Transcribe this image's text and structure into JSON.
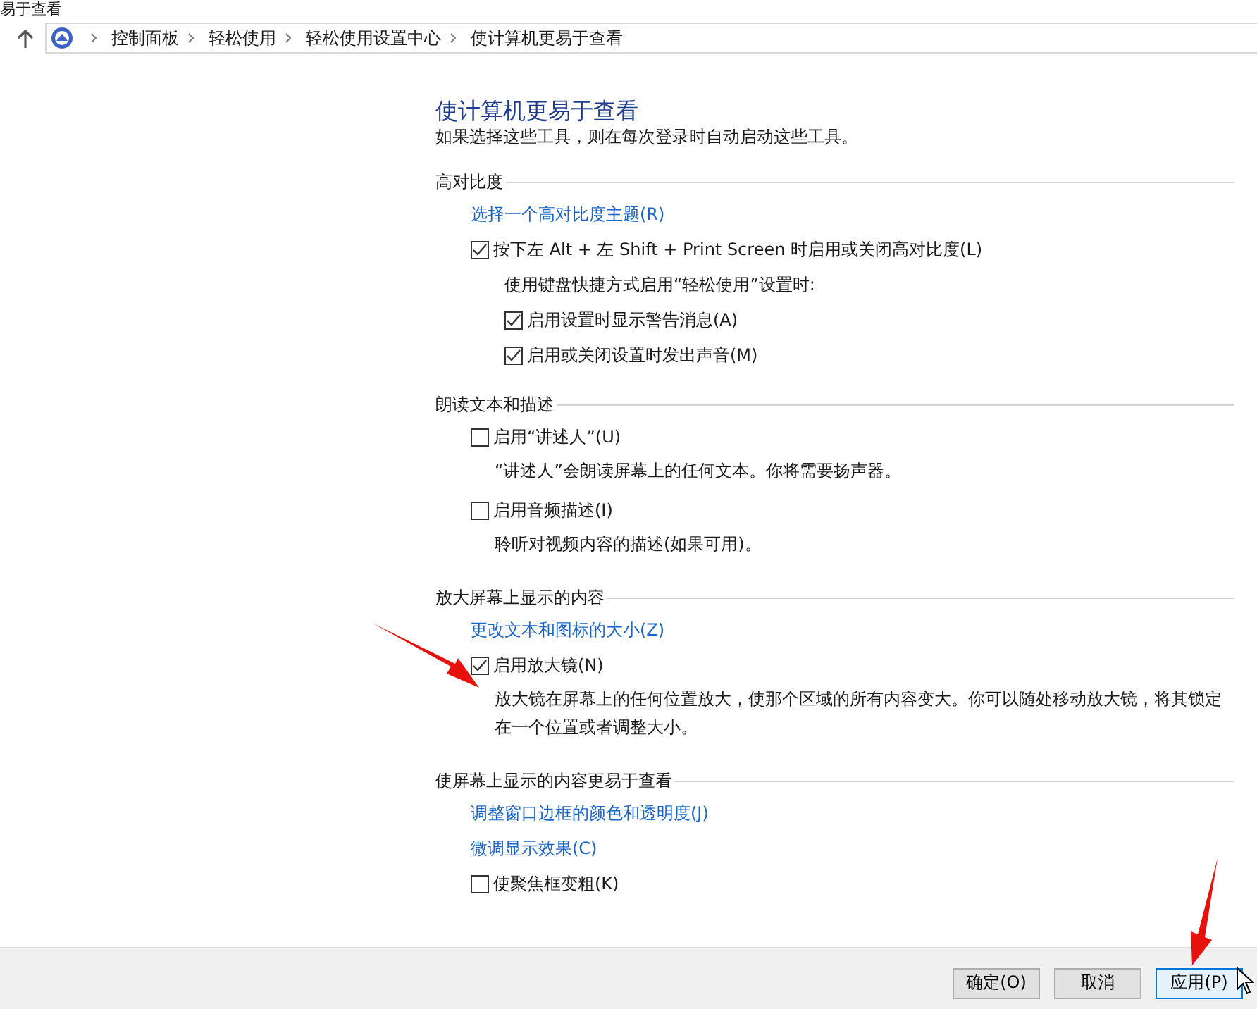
{
  "window": {
    "title": "易于查看"
  },
  "breadcrumb": [
    "控制面板",
    "轻松使用",
    "轻松使用设置中心",
    "使计算机更易于查看"
  ],
  "page": {
    "title": "使计算机更易于查看",
    "subtitle": "如果选择这些工具，则在每次登录时自动启动这些工具。"
  },
  "sections": [
    {
      "heading": "高对比度",
      "items": [
        {
          "kind": "link",
          "label": "选择一个高对比度主题(R)"
        },
        {
          "kind": "checkbox",
          "label": "按下左 Alt + 左 Shift + Print Screen 时启用或关闭高对比度(L)",
          "checked": true,
          "children": [
            {
              "kind": "note",
              "label": "使用键盘快捷方式启用“轻松使用”设置时:"
            },
            {
              "kind": "checkbox",
              "label": "启用设置时显示警告消息(A)",
              "checked": true
            },
            {
              "kind": "checkbox",
              "label": "启用或关闭设置时发出声音(M)",
              "checked": true
            }
          ]
        }
      ]
    },
    {
      "heading": "朗读文本和描述",
      "items": [
        {
          "kind": "checkbox",
          "label": "启用“讲述人”(U)",
          "checked": false,
          "description": "“讲述人”会朗读屏幕上的任何文本。你将需要扬声器。"
        },
        {
          "kind": "checkbox",
          "label": "启用音频描述(I)",
          "checked": false,
          "description": "聆听对视频内容的描述(如果可用)。"
        }
      ]
    },
    {
      "heading": "放大屏幕上显示的内容",
      "items": [
        {
          "kind": "link",
          "label": "更改文本和图标的大小(Z)"
        },
        {
          "kind": "checkbox",
          "label": "启用放大镜(N)",
          "checked": true,
          "description": "放大镜在屏幕上的任何位置放大，使那个区域的所有内容变大。你可以随处移动放大镜，将其锁定在一个位置或者调整大小。"
        }
      ]
    },
    {
      "heading": "使屏幕上显示的内容更易于查看",
      "items": [
        {
          "kind": "link",
          "label": "调整窗口边框的颜色和透明度(J)"
        },
        {
          "kind": "link",
          "label": "微调显示效果(C)"
        },
        {
          "kind": "checkbox",
          "label": "使聚焦框变粗(K)",
          "checked": false
        }
      ]
    }
  ],
  "buttons": [
    {
      "label": "确定(O)",
      "selected": false
    },
    {
      "label": "取消",
      "selected": false
    },
    {
      "label": "应用(P)",
      "selected": true
    }
  ]
}
